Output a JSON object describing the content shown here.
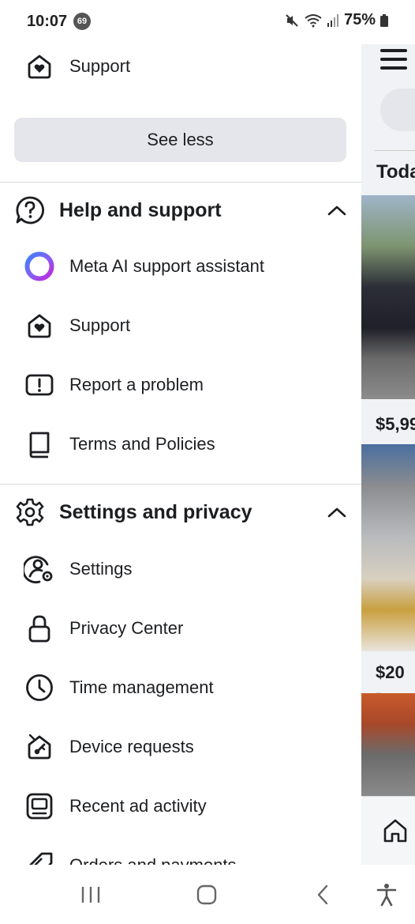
{
  "status_bar": {
    "time": "10:07",
    "notification_count": "69",
    "battery": "75%"
  },
  "drawer": {
    "top_item": {
      "label": "Support",
      "icon": "heart-home-icon"
    },
    "see_less_label": "See less",
    "help_section": {
      "title": "Help and support",
      "items": [
        {
          "label": "Meta AI support assistant",
          "icon": "meta-ai-ring-icon"
        },
        {
          "label": "Support",
          "icon": "heart-home-icon"
        },
        {
          "label": "Report a problem",
          "icon": "alert-box-icon"
        },
        {
          "label": "Terms and Policies",
          "icon": "book-icon"
        }
      ]
    },
    "settings_section": {
      "title": "Settings and privacy",
      "items": [
        {
          "label": "Settings",
          "icon": "user-gear-icon"
        },
        {
          "label": "Privacy Center",
          "icon": "lock-icon"
        },
        {
          "label": "Time management",
          "icon": "clock-icon"
        },
        {
          "label": "Device requests",
          "icon": "home-key-icon"
        },
        {
          "label": "Recent ad activity",
          "icon": "ad-screen-icon"
        },
        {
          "label": "Orders and payments",
          "icon": "tag-icon"
        }
      ]
    }
  },
  "background_feed": {
    "section_label": "Toda",
    "prices": [
      "$5,99",
      "$20 -"
    ]
  },
  "colors": {
    "accent_meta_ai_start": "#3b82f6",
    "accent_meta_ai_end": "#c026d3",
    "button_bg": "#e4e6eb",
    "divider": "#d6d8dc"
  }
}
